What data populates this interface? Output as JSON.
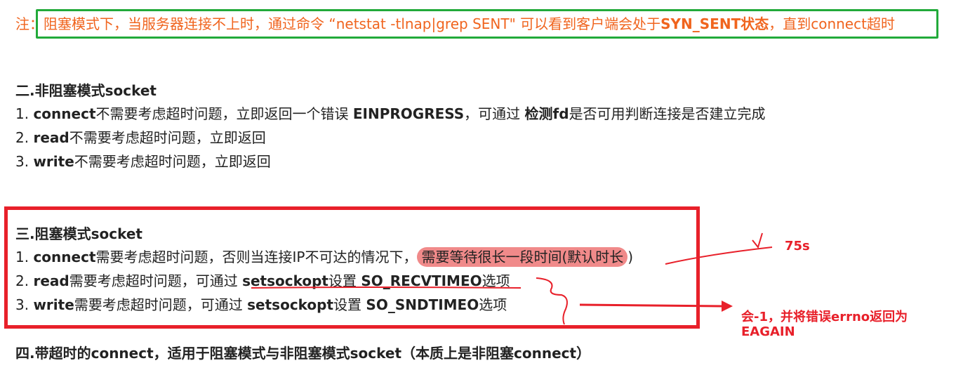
{
  "note": {
    "prefix": "注：",
    "text_before": "阻塞模式下，当服务器连接不上时，通过命令 “netstat -tlnap|grep SENT\" 可以看到客户端会处于",
    "bold": "SYN_SENT状态",
    "text_after": "，直到connect超时"
  },
  "section2": {
    "title": "二.非阻塞模式socket",
    "items": [
      {
        "num": "1. ",
        "bold1": "connect",
        "text1": "不需要考虑超时问题，立即返回一个错误 ",
        "bold2": "EINPROGRESS",
        "text2": "，可通过 ",
        "bold3": "检测fd",
        "text3": "是否可用判断连接是否建立完成"
      },
      {
        "num": "2. ",
        "bold1": "read",
        "text1": "不需要考虑超时问题，立即返回"
      },
      {
        "num": "3. ",
        "bold1": "write",
        "text1": "不需要考虑超时问题，立即返回"
      }
    ]
  },
  "section3": {
    "title": "三.阻塞模式socket",
    "item1": {
      "num": "1. ",
      "bold1": "connect",
      "text1": "需要考虑超时问题，否则当连接IP不可达的情况下，",
      "highlight": "需要等待很长一段时间(默认时长",
      "tail": ")"
    },
    "item2": {
      "num": "2. ",
      "bold1": "read",
      "text1": "需要考虑超时问题，可通过 ",
      "bold2": "setsockopt",
      "text2": "设置 ",
      "bold3": "SO_RECVTIMEO",
      "text3": "选项"
    },
    "item3": {
      "num": "3. ",
      "bold1": "write",
      "text1": "需要考虑超时问题，可通过 ",
      "bold2": "setsockopt",
      "text2": "设置 ",
      "bold3": "SO_SNDTIMEO",
      "text3": "选项"
    }
  },
  "section4": {
    "title": "四.带超时的connect，适用于阻塞模式与非阻塞模式socket（本质上是非阻塞connect）"
  },
  "annotations": {
    "timeout": "75s",
    "errno_line1": "会-1，并将错误errno返回为",
    "errno_line2": "EAGAIN"
  },
  "colors": {
    "note": "#f0641e",
    "green_box": "#22aa3a",
    "red": "#e8202a",
    "highlight": "#f08a8a"
  }
}
